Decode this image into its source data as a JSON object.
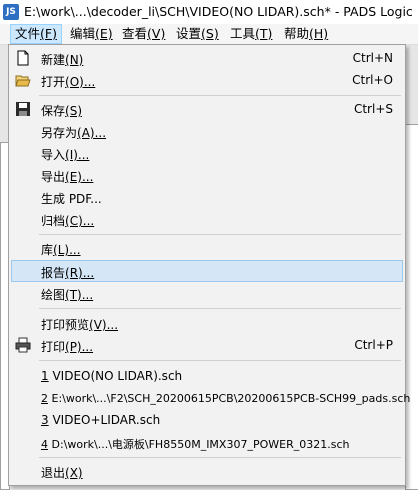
{
  "title": {
    "app_icon_text": "JS",
    "text": "E:\\work\\...\\decoder_li\\SCH\\VIDEO(NO LIDAR).sch* - PADS Logic"
  },
  "menubar": [
    {
      "label": "文件",
      "key": "(F)",
      "active": true
    },
    {
      "label": "编辑",
      "key": "(E)"
    },
    {
      "label": "查看",
      "key": "(V)"
    },
    {
      "label": "设置",
      "key": "(S)"
    },
    {
      "label": "工具",
      "key": "(T)"
    },
    {
      "label": "帮助",
      "key": "(H)"
    }
  ],
  "file_menu": {
    "new": {
      "label": "新建",
      "key": "(N)",
      "shortcut": "Ctrl+N",
      "icon": "new-file-icon"
    },
    "open": {
      "label": "打开",
      "key": "(O)...",
      "shortcut": "Ctrl+O",
      "icon": "open-folder-icon"
    },
    "save": {
      "label": "保存",
      "key": "(S)",
      "shortcut": "Ctrl+S",
      "icon": "save-disk-icon"
    },
    "save_as": {
      "label": "另存为",
      "key": "(A)..."
    },
    "import": {
      "label": "导入",
      "key": "(I)..."
    },
    "export": {
      "label": "导出",
      "key": "(E)..."
    },
    "pdf": {
      "label": "生成 PDF",
      "key": "..."
    },
    "archive": {
      "label": "归档",
      "key": "(C)..."
    },
    "library": {
      "label": "库",
      "key": "(L)..."
    },
    "reports": {
      "label": "报告",
      "key": "(R)..."
    },
    "plot": {
      "label": "绘图",
      "key": "(T)..."
    },
    "print_preview": {
      "label": "打印预览",
      "key": "(V)..."
    },
    "print": {
      "label": "打印",
      "key": "(P)...",
      "shortcut": "Ctrl+P",
      "icon": "printer-icon"
    },
    "recent": [
      {
        "num": "1",
        "path": " VIDEO(NO LIDAR).sch"
      },
      {
        "num": "2",
        "path": " E:\\work\\...\\F2\\SCH_20200615PCB\\20200615PCB-SCH99_pads.sch"
      },
      {
        "num": "3",
        "path": " VIDEO+LIDAR.sch"
      },
      {
        "num": "4",
        "path": " D:\\work\\...\\电源板\\FH8550M_IMX307_POWER_0321.sch"
      }
    ],
    "exit": {
      "label": "退出",
      "key": "(X)"
    }
  },
  "colors": {
    "highlight": "#d5e7f7",
    "menubar_active": "#cce8ff"
  }
}
